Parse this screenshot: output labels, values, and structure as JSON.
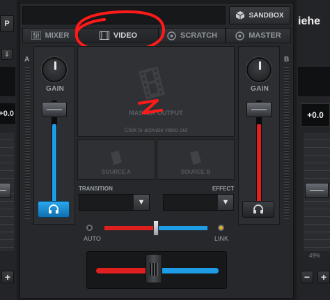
{
  "left_deck": {
    "key_label": "P",
    "pitch_value": "+0.0",
    "plus_label": "+"
  },
  "right_deck": {
    "title_partial": "iehe",
    "pitch_value": "+0.0",
    "pitch_percent": "49%",
    "minus_label": "−",
    "plus_label": "+"
  },
  "toolbar": {
    "sandbox_label": "SANDBOX"
  },
  "tabs": [
    {
      "label": "MIXER",
      "icon": "mixer-icon"
    },
    {
      "label": "VIDEO",
      "icon": "film-icon",
      "active": true
    },
    {
      "label": "SCRATCH",
      "icon": "disc-icon"
    },
    {
      "label": "MASTER",
      "icon": "disc-icon"
    }
  ],
  "deck_a": {
    "letter": "A",
    "gain_label": "GAIN",
    "fader_level": 0.78,
    "accent": "#1e9ce6"
  },
  "deck_b": {
    "letter": "B",
    "gain_label": "GAIN",
    "fader_level": 0.78,
    "accent": "#e01f1f"
  },
  "video": {
    "master_output_label": "MASTER OUTPUT",
    "activate_hint": "Click to activate video out",
    "source_a_label": "SOURCE A",
    "source_b_label": "SOURCE B",
    "transition_label": "TRANSITION",
    "effect_label": "EFFECT",
    "auto_label": "AUTO",
    "link_label": "LINK",
    "video_crossfader_position": 0.5
  },
  "crossfader": {
    "position": 0.47
  },
  "annotation_color": "#ff1a1a"
}
